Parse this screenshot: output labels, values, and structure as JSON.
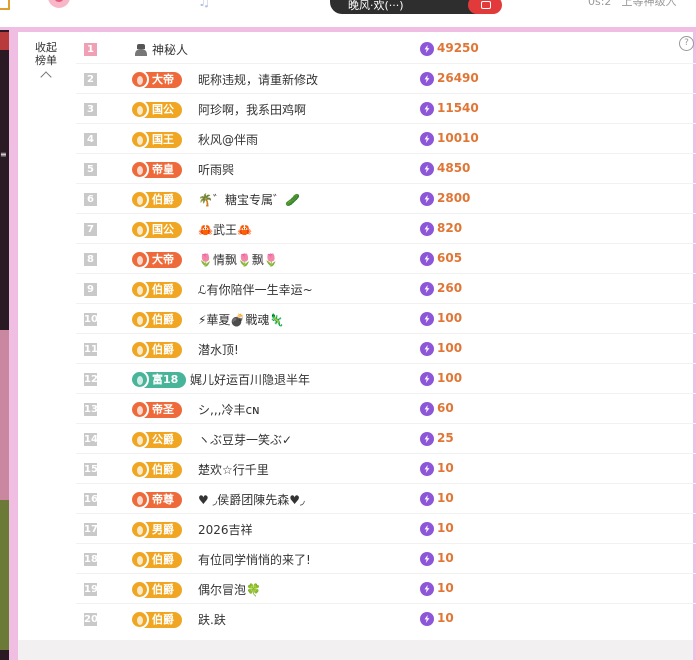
{
  "top": {
    "button_text": "晚风·欢(···)",
    "right_text": "0s:2 ' 上等神级入"
  },
  "panel": {
    "collapse_label_line1": "收起",
    "collapse_label_line2": "榜单",
    "help_icon": "?"
  },
  "colors": {
    "panel_border": "#f0bde3",
    "value_text": "#e07636",
    "bolt": "#8d56d8",
    "badge_orange": "#f0a623",
    "badge_red": "#ef6a3a",
    "badge_teal": "#48b59a"
  },
  "ranking": [
    {
      "rank": "1",
      "badge": "",
      "badge_color": "",
      "name": "神秘人",
      "value": "49250",
      "icon": "mystery-user-icon"
    },
    {
      "rank": "2",
      "badge": "大帝",
      "badge_color": "red",
      "name": "昵称违规，请重新修改",
      "value": "26490"
    },
    {
      "rank": "3",
      "badge": "国公",
      "badge_color": "orange",
      "name": "阿珍啊，我系田鸡啊",
      "value": "11540"
    },
    {
      "rank": "4",
      "badge": "国王",
      "badge_color": "orange",
      "name": "秋风@伴雨",
      "value": "10010"
    },
    {
      "rank": "5",
      "badge": "帝皇",
      "badge_color": "red",
      "name": "听雨巺",
      "value": "4850"
    },
    {
      "rank": "6",
      "badge": "伯爵",
      "badge_color": "orange",
      "name": "🌴゛糖宝专属゛🥒",
      "value": "2800"
    },
    {
      "rank": "7",
      "badge": "国公",
      "badge_color": "orange",
      "name": "🦀武王🦀",
      "value": "820"
    },
    {
      "rank": "8",
      "badge": "大帝",
      "badge_color": "red",
      "name": "🌷情飘🌷飘🌷",
      "value": "605"
    },
    {
      "rank": "9",
      "badge": "伯爵",
      "badge_color": "orange",
      "name": "ℒ有你陪伴一生幸运~",
      "value": "260"
    },
    {
      "rank": "10",
      "badge": "伯爵",
      "badge_color": "orange",
      "name": "⚡華夏💣戰魂🦎",
      "value": "100"
    },
    {
      "rank": "11",
      "badge": "伯爵",
      "badge_color": "orange",
      "name": "潜水顶!",
      "value": "100"
    },
    {
      "rank": "12",
      "badge": "富18",
      "badge_color": "teal",
      "name": "娓儿好运百川隐退半年",
      "value": "100"
    },
    {
      "rank": "13",
      "badge": "帝圣",
      "badge_color": "red",
      "name": "シ,,,冷丰ᴄɴ",
      "value": "60"
    },
    {
      "rank": "14",
      "badge": "公爵",
      "badge_color": "orange",
      "name": "ヽぶ豆芽一笑ぶ✓",
      "value": "25"
    },
    {
      "rank": "15",
      "badge": "伯爵",
      "badge_color": "orange",
      "name": "楚欢☆行千里",
      "value": "10"
    },
    {
      "rank": "16",
      "badge": "帝尊",
      "badge_color": "red",
      "name": "♥ ◞侯爵团陳先森♥◞",
      "value": "10"
    },
    {
      "rank": "17",
      "badge": "男爵",
      "badge_color": "orange",
      "name": "2026吉祥",
      "value": "10"
    },
    {
      "rank": "18",
      "badge": "伯爵",
      "badge_color": "orange",
      "name": "有位同学悄悄的来了!",
      "value": "10"
    },
    {
      "rank": "19",
      "badge": "伯爵",
      "badge_color": "orange",
      "name": "偶尔冒泡🍀",
      "value": "10"
    },
    {
      "rank": "20",
      "badge": "伯爵",
      "badge_color": "orange",
      "name": "趺.趺",
      "value": "10"
    }
  ]
}
